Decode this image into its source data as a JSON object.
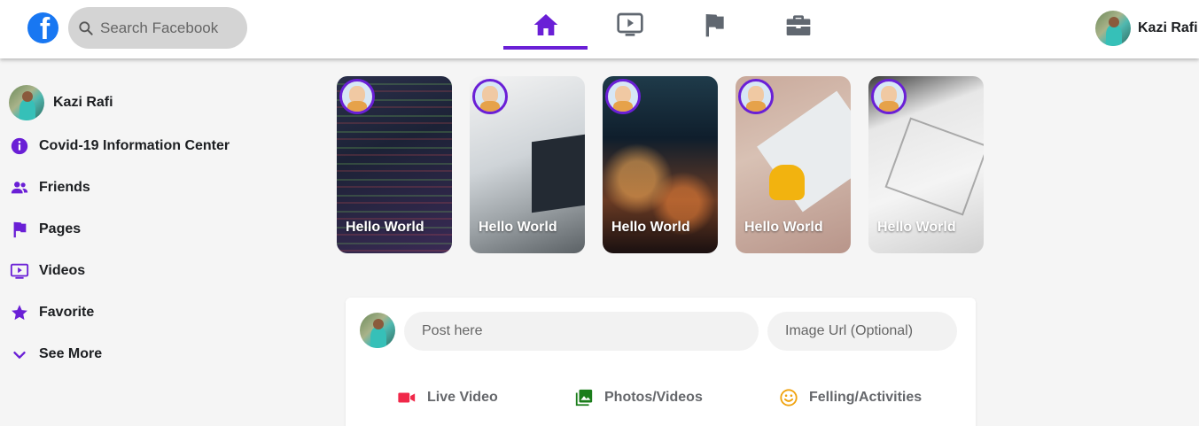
{
  "header": {
    "logo_letter": "f",
    "search": {
      "placeholder": "Search Facebook"
    },
    "tabs": [
      {
        "name": "home",
        "active": true
      },
      {
        "name": "watch",
        "active": false
      },
      {
        "name": "pages",
        "active": false
      },
      {
        "name": "marketplace",
        "active": false
      }
    ],
    "user_name": "Kazi Rafi"
  },
  "sidebar": {
    "profile_name": "Kazi Rafi",
    "items": [
      {
        "label": "Covid-19 Information Center",
        "icon": "info-icon"
      },
      {
        "label": "Friends",
        "icon": "friends-icon"
      },
      {
        "label": "Pages",
        "icon": "flag-icon"
      },
      {
        "label": "Videos",
        "icon": "video-icon"
      },
      {
        "label": "Favorite",
        "icon": "star-icon"
      },
      {
        "label": "See More",
        "icon": "chevron-down-icon"
      }
    ]
  },
  "stories": [
    {
      "title": "Hello World"
    },
    {
      "title": "Hello World"
    },
    {
      "title": "Hello World"
    },
    {
      "title": "Hello World"
    },
    {
      "title": "Hello World"
    }
  ],
  "composer": {
    "post_placeholder": "Post here",
    "url_placeholder": "Image Url (Optional)",
    "actions": [
      {
        "label": "Live Video",
        "icon": "live-video-icon",
        "color": "#f02849"
      },
      {
        "label": "Photos/Videos",
        "icon": "photo-icon",
        "color": "#1b7d1b"
      },
      {
        "label": "Felling/Activities",
        "icon": "smile-icon",
        "color": "#f0a30f"
      }
    ]
  },
  "colors": {
    "accent": "#6a1fd6",
    "facebook_blue": "#1877f2",
    "icon_gray": "#606770"
  }
}
